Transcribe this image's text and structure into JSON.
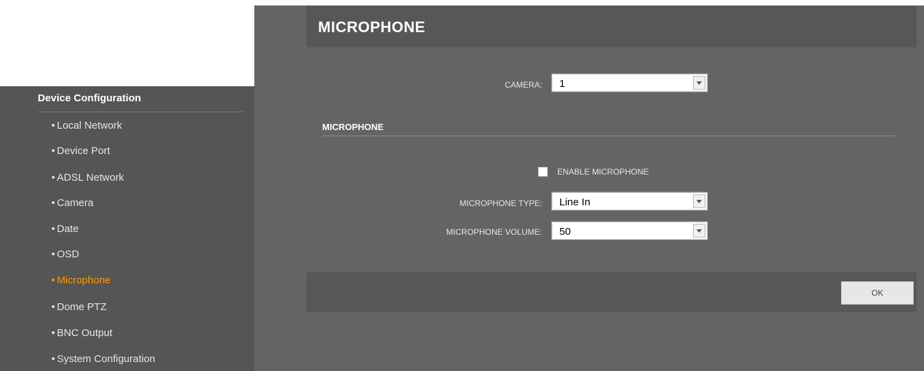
{
  "sidebar": {
    "title": "Device Configuration",
    "items": [
      {
        "label": "Local Network",
        "active": false
      },
      {
        "label": "Device Port",
        "active": false
      },
      {
        "label": "ADSL Network",
        "active": false
      },
      {
        "label": "Camera",
        "active": false
      },
      {
        "label": "Date",
        "active": false
      },
      {
        "label": "OSD",
        "active": false
      },
      {
        "label": "Microphone",
        "active": true
      },
      {
        "label": "Dome PTZ",
        "active": false
      },
      {
        "label": "BNC Output",
        "active": false
      },
      {
        "label": "System Configuration",
        "active": false
      }
    ],
    "bullet": "•",
    "active_color": "#ff9900"
  },
  "page": {
    "title": "MICROPHONE",
    "camera_label": "CAMERA:",
    "camera_value": "1",
    "section_title": "MICROPHONE",
    "enable_label": "ENABLE MICROPHONE",
    "enable_checked": false,
    "type_label": "MICROPHONE TYPE:",
    "type_value": "Line In",
    "volume_label": "MICROPHONE VOLUME:",
    "volume_value": "50",
    "ok_label": "OK"
  },
  "icons": {
    "dropdown": "chevron-down-icon",
    "bullet": "bullet-icon"
  }
}
